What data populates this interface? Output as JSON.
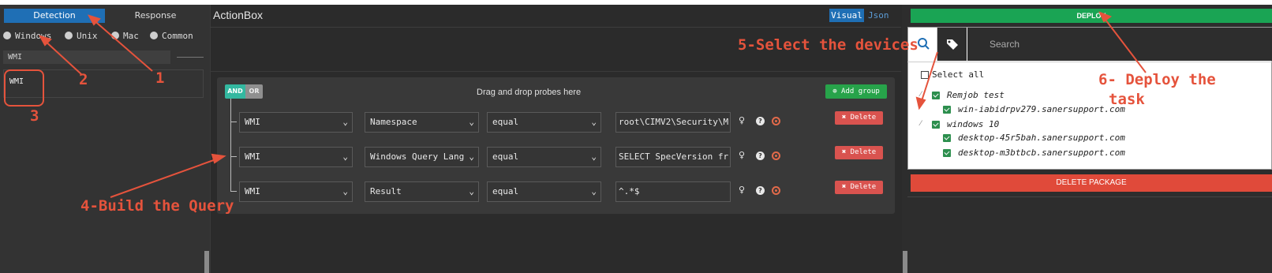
{
  "left_panel": {
    "tabs": [
      "Detection",
      "Response"
    ],
    "os_options": [
      "Windows",
      "Unix",
      "Mac",
      "Common"
    ],
    "search_value": "WMI",
    "probes": [
      "WMI"
    ]
  },
  "action_box": {
    "title": "ActionBox",
    "view_modes": {
      "visual": "Visual",
      "json": "Json"
    },
    "logic": {
      "and": "AND",
      "or": "OR"
    },
    "drag_hint": "Drag and drop probes here",
    "add_group": "Add group",
    "rows": [
      {
        "probe": "WMI",
        "attribute": "Namespace",
        "operator": "equal",
        "value": "root\\CIMV2\\Security\\M",
        "delete": "Delete"
      },
      {
        "probe": "WMI",
        "attribute": "Windows Query Lang",
        "operator": "equal",
        "value": "SELECT SpecVersion fr",
        "delete": "Delete"
      },
      {
        "probe": "WMI",
        "attribute": "Result",
        "operator": "equal",
        "value": "^.*$",
        "delete": "Delete"
      }
    ]
  },
  "right_panel": {
    "deploy": "DEPLOY",
    "search_placeholder": "Search",
    "select_all": "Select all",
    "groups": [
      {
        "name": "Remjob test",
        "devices": [
          "win-iabidrpv279.sanersupport.com"
        ]
      },
      {
        "name": "windows 10",
        "devices": [
          "desktop-45r5bah.sanersupport.com",
          "desktop-m3btbcb.sanersupport.com"
        ]
      }
    ],
    "delete_package": "DELETE PACKAGE"
  },
  "annotations": {
    "n1": "1",
    "n2": "2",
    "n3": "3",
    "n4": "4-Build the Query",
    "n5": "5-Select the devices",
    "n6a": "6- Deploy the",
    "n6b": "task"
  },
  "colors": {
    "annotation": "#e5533c",
    "primary": "#1f6fb5",
    "deploy": "#1aa454",
    "danger": "#e04a3a"
  }
}
